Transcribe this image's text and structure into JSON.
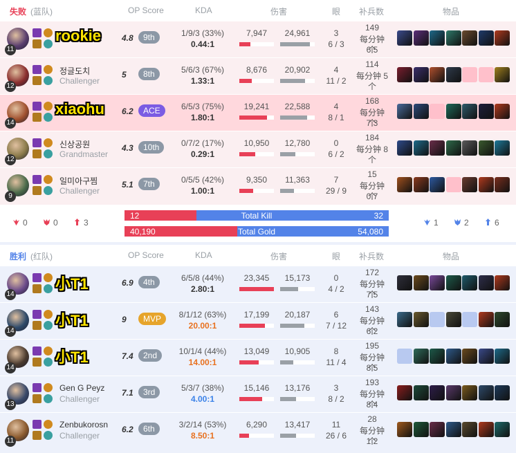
{
  "columns": {
    "op_score": "OP Score",
    "kda": "KDA",
    "damage": "伤害",
    "wards": "眼",
    "cs": "补兵数",
    "items": "物品"
  },
  "red_team": {
    "result": "失败",
    "side": "(蓝队)",
    "players": [
      {
        "name": "rookie",
        "rank": "",
        "big_label": true,
        "level": "11",
        "score": "4.8",
        "badge": "9th",
        "kda_line": "1/9/3 (33%)",
        "kda_ratio": "0.44:1",
        "dmg_dealt": "7,947",
        "dmg_taken": "24,961",
        "dealt_pct": 0.32,
        "taken_pct": 0.86,
        "wards": "3",
        "wards2": "6 / 3",
        "cs": "149",
        "cs_rate": "每分钟 6.5",
        "cs_unit": "个",
        "champ_color": "#5a3e6e",
        "items": [
          "#3a4a8c",
          "#5c2e7a",
          "#1e6a8a",
          "#2e7a6a",
          "#6a4a2e",
          "#1e3a6a",
          "#b03a1e"
        ]
      },
      {
        "name": "정글도치",
        "rank": "Challenger",
        "big_label": false,
        "level": "12",
        "score": "5",
        "badge": "8th",
        "kda_line": "5/6/3 (67%)",
        "kda_ratio": "1.33:1",
        "dmg_dealt": "8,676",
        "dmg_taken": "20,902",
        "dealt_pct": 0.36,
        "taken_pct": 0.72,
        "wards": "4",
        "wards2": "11 / 2",
        "cs": "114",
        "cs_rate": "每分钟 5",
        "cs_unit": "个",
        "champ_color": "#8a2e2e",
        "items": [
          "#7a1e2e",
          "#3a2e6a",
          "#b0502e",
          "#2e3a4a",
          "empty",
          "empty",
          "#a0801e"
        ]
      },
      {
        "name": "xiaohu",
        "rank": "",
        "big_label": true,
        "level": "14",
        "score": "6.2",
        "badge": "ACE",
        "kda_line": "6/5/3 (75%)",
        "kda_ratio": "1.80:1",
        "dmg_dealt": "19,241",
        "dmg_taken": "22,588",
        "dealt_pct": 0.8,
        "taken_pct": 0.78,
        "wards": "4",
        "wards2": "8 / 1",
        "cs": "168",
        "cs_rate": "每分钟 7.3",
        "cs_unit": "个",
        "champ_color": "#a0502e",
        "items": [
          "#4a6a9a",
          "#2e4a7a",
          "empty",
          "#1e6a5a",
          "#2e5a6a",
          "#1e1e3a",
          "#b03a1e"
        ]
      },
      {
        "name": "신상공원",
        "rank": "Grandmaster",
        "big_label": false,
        "level": "12",
        "score": "4.3",
        "badge": "10th",
        "kda_line": "0/7/2 (17%)",
        "kda_ratio": "0.29:1",
        "dmg_dealt": "10,950",
        "dmg_taken": "12,780",
        "dealt_pct": 0.46,
        "taken_pct": 0.44,
        "wards": "0",
        "wards2": "6 / 2",
        "cs": "184",
        "cs_rate": "每分钟 8",
        "cs_unit": "个",
        "champ_color": "#8a7a4a",
        "items": [
          "#2e4a8a",
          "#1e6a8a",
          "#6a2e4a",
          "#2e6a4a",
          "#5a5a5a",
          "#3a5a2e",
          "#1e7a9a"
        ]
      },
      {
        "name": "일미아구찜",
        "rank": "Challenger",
        "big_label": false,
        "level": "9",
        "score": "5.1",
        "badge": "7th",
        "kda_line": "0/5/5 (42%)",
        "kda_ratio": "1.00:1",
        "dmg_dealt": "9,350",
        "dmg_taken": "11,363",
        "dealt_pct": 0.39,
        "taken_pct": 0.39,
        "wards": "7",
        "wards2": "29 / 9",
        "cs": "15",
        "cs_rate": "每分钟 0.7",
        "cs_unit": "个",
        "champ_color": "#4a6a4a",
        "items": [
          "#a0501e",
          "#8a3a1e",
          "#2e5aa0",
          "empty",
          "#6a3a2e",
          "#b03a1e",
          "#7a2e1e"
        ]
      }
    ]
  },
  "summary": {
    "red_objectives": [
      {
        "icon": "baron-icon",
        "value": "0"
      },
      {
        "icon": "dragon-icon",
        "value": "0"
      },
      {
        "icon": "tower-icon",
        "value": "3"
      }
    ],
    "blue_objectives": [
      {
        "icon": "baron-icon",
        "value": "1"
      },
      {
        "icon": "dragon-icon",
        "value": "2"
      },
      {
        "icon": "tower-icon",
        "value": "6"
      }
    ],
    "kill_red": "12",
    "kill_label": "Total Kill",
    "kill_blue": "32",
    "kill_red_frac": 0.273,
    "gold_red": "40,190",
    "gold_label": "Total Gold",
    "gold_blue": "54,080",
    "gold_red_frac": 0.426
  },
  "blue_team": {
    "result": "胜利",
    "side": "(红队)",
    "players": [
      {
        "name": "小T1",
        "rank": "",
        "big_label": true,
        "level": "14",
        "score": "6.9",
        "badge": "4th",
        "kda_line": "6/5/8 (44%)",
        "kda_ratio": "2.80:1",
        "kda_color": "normal",
        "dmg_dealt": "23,345",
        "dmg_taken": "15,173",
        "dealt_pct": 1.0,
        "taken_pct": 0.52,
        "wards": "0",
        "wards2": "4 / 2",
        "cs": "172",
        "cs_rate": "每分钟 7.5",
        "cs_unit": "个",
        "champ_color": "#6a4a8a",
        "items": [
          "#2e2e3a",
          "#6a4a1e",
          "#7a4a9a",
          "#1e5a4a",
          "#1e5a6a",
          "#2e2e4a",
          "#b03a1e"
        ]
      },
      {
        "name": "小T1",
        "rank": "",
        "big_label": true,
        "level": "14",
        "score": "9",
        "badge": "MVP",
        "kda_line": "8/1/12 (63%)",
        "kda_ratio": "20.00:1",
        "kda_color": "orange",
        "dmg_dealt": "17,199",
        "dmg_taken": "20,187",
        "dealt_pct": 0.74,
        "taken_pct": 0.69,
        "wards": "6",
        "wards2": "7 / 12",
        "cs": "143",
        "cs_rate": "每分钟 6.2",
        "cs_unit": "个",
        "champ_color": "#2e4a6a",
        "items": [
          "#3a6a8a",
          "#6a5a2e",
          "empty",
          "#4a4a3a",
          "empty",
          "#b03a1e",
          "#2e4a2e"
        ]
      },
      {
        "name": "小T1",
        "rank": "",
        "big_label": true,
        "level": "14",
        "score": "7.4",
        "badge": "2nd",
        "kda_line": "10/1/4 (44%)",
        "kda_ratio": "14.00:1",
        "kda_color": "orange",
        "dmg_dealt": "13,049",
        "dmg_taken": "10,905",
        "dealt_pct": 0.56,
        "taken_pct": 0.37,
        "wards": "8",
        "wards2": "11 / 4",
        "cs": "195",
        "cs_rate": "每分钟 8.5",
        "cs_unit": "个",
        "champ_color": "#4a3a2e",
        "items": [
          "empty",
          "#2e6a5a",
          "#1e5a4a",
          "#2e5a8a",
          "#6a4a1e",
          "#3a4a8a",
          "#1e6a8a"
        ]
      },
      {
        "name": "Gen G Peyz",
        "rank": "Challenger",
        "big_label": false,
        "level": "13",
        "score": "7.1",
        "badge": "3rd",
        "kda_line": "5/3/7 (38%)",
        "kda_ratio": "4.00:1",
        "kda_color": "blue",
        "dmg_dealt": "15,146",
        "dmg_taken": "13,176",
        "dealt_pct": 0.65,
        "taken_pct": 0.45,
        "wards": "3",
        "wards2": "8 / 2",
        "cs": "193",
        "cs_rate": "每分钟 8.4",
        "cs_unit": "个",
        "champ_color": "#3a4a6a",
        "items": [
          "#8a1e1e",
          "#1e4a3a",
          "#2e1e4a",
          "#5a3a6a",
          "#7a5a1e",
          "#2e4a6a",
          "#1e3a5a"
        ]
      },
      {
        "name": "Zenbukorosn",
        "rank": "Challenger",
        "big_label": false,
        "level": "11",
        "score": "6.2",
        "badge": "6th",
        "kda_line": "3/2/14 (53%)",
        "kda_ratio": "8.50:1",
        "kda_color": "orange",
        "dmg_dealt": "6,290",
        "dmg_taken": "13,417",
        "dealt_pct": 0.27,
        "taken_pct": 0.46,
        "wards": "11",
        "wards2": "26 / 6",
        "cs": "28",
        "cs_rate": "每分钟 1.2",
        "cs_unit": "个",
        "champ_color": "#8a5a2e",
        "items": [
          "#a05a1e",
          "#1e5a3a",
          "#6a2e4a",
          "#2e5a8a",
          "#5a4a2e",
          "#b03a1e",
          "#1e6a6a"
        ]
      }
    ]
  }
}
